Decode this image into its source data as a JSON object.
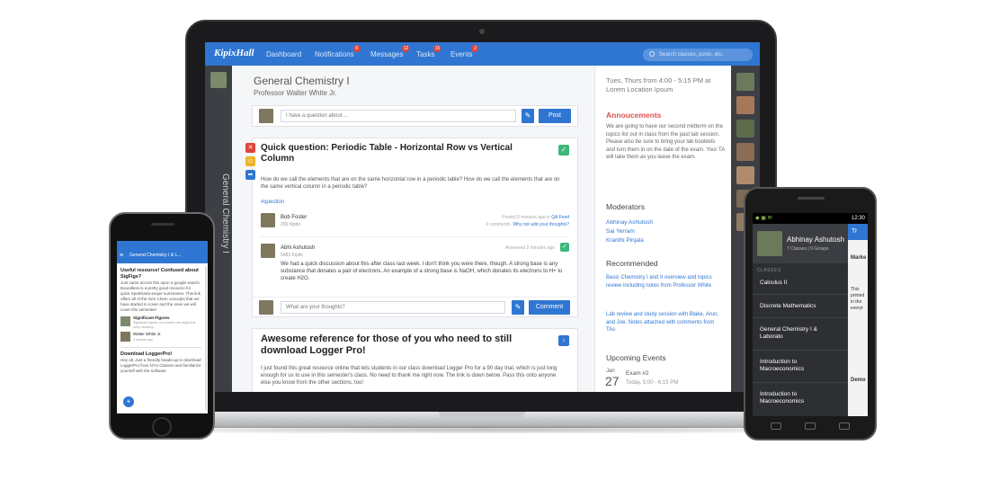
{
  "app": {
    "logo": "KipixHall",
    "nav": [
      {
        "label": "Dashboard",
        "badge": ""
      },
      {
        "label": "Notifications",
        "badge": "8"
      },
      {
        "label": "Messages",
        "badge": "12"
      },
      {
        "label": "Tasks",
        "badge": "15"
      },
      {
        "label": "Events",
        "badge": "2"
      }
    ],
    "search_placeholder": "Search classes, posts, etc.",
    "sidebar_title": "General Chemistry I"
  },
  "course": {
    "title": "General Chemistry I",
    "professor": "Professor Walter White Jr."
  },
  "composer": {
    "placeholder": "I have a question about ...",
    "post_label": "Post"
  },
  "post1": {
    "title": "Quick question: Periodic Table - Horizontal Row vs Vertical Column",
    "body": "How do we call the elements that are on the same horizontal row in a periodic table? How do we call the elements that are on the same vertical column in a periodic table?",
    "hashtag": "#question",
    "author": "Bob Foster",
    "author_points": "265 Kipits",
    "posted_meta": "Posted 5 minutes ago in",
    "posted_link": "QA Feed",
    "comments_meta": "0 comments.",
    "comments_link": "Why not add your thoughts?",
    "answer_author": "Abhi Ashutosh",
    "answer_points": "5483 Kipits",
    "answer_meta": "Answered 2 minutes ago",
    "answer_body": "We had a quick discussion about this after class last week. I don't think you were there, though. A strong base is any substance that donates a pair of electrons. An example of a strong base is NaOH, which donates its electrons to H+ to create H2O.",
    "reply_placeholder": "What are your thoughts?",
    "comment_label": "Comment"
  },
  "post2": {
    "title": "Awesome reference for those of you who need to still download Logger Pro!",
    "body": "I just found this great resource online that lets students in our class download Logger Pro for a 90 day trial, which is just long enough for us to use in this semester's class. No need to thank me right now. The link is down below. Pass this onto anyone else you know from the other sections, too!"
  },
  "right_panel": {
    "schedule": "Tues, Thurs from 4:00 - 5:15 PM at Lorem Location Ipsum",
    "announcements_title": "Annoucements",
    "announcements_body": "We are going to have our second midterm on the topics list out in class from the past lab session. Please also be sure to bring your lab booklets and turn them in on the date of the exam. Your TA will take them as you leave the exam.",
    "moderators_title": "Moderators",
    "moderators": [
      "Abhinay Ashutosh",
      "Sai Yerram",
      "Kranthi Pinjala"
    ],
    "recommended_title": "Recommended",
    "recommended": [
      "Basic Chemistry I and II overview and topics review including notes from Professor White",
      "Lab review and study session with Blake, Arun, and Joe. Notes attached with comments from TAs"
    ],
    "events_title": "Upcoming Events",
    "event_month": "Jan",
    "event_day": "27",
    "event_title": "Exam #2",
    "event_time": "Today, 5:00 - 6:15 PM"
  },
  "iphone": {
    "header": "General Chemistry I & L...",
    "post_title": "Useful resource! Confused about SigFigs?",
    "post_body": "Just came across this upon a google search. Boundless is a pretty good resource for quick SparkNote-esque summaries. This link offers all of the Gen Chem concepts that we have started to cover and the ones we will cover this semester!",
    "attachment_title": "Significant Figures",
    "attachment_sub": "Significant figures of a number are digits that carry meaning...",
    "author": "Walter White Jr.",
    "author_sub": "3 minutes ago",
    "post2_title": "Download LoggerPro!",
    "post2_body": "Hey all, Just a friendly heads-up to download LoggerPro from NYU Classes and familiarize yourself with the software"
  },
  "android": {
    "time": "12:30",
    "user_name": "Abhinay Ashutosh",
    "user_sub": "7 Classes | 9 Groups",
    "classes_label": "CLASSES",
    "classes": [
      "Calculus II",
      "Discrete Mathematics",
      "General Chemistry I & Laborato",
      "Introduction to Macroeconomics",
      "Introduction to Macroeconomics"
    ],
    "behind_header": "Tr",
    "behind_lines": [
      "Marke",
      "This printed in the everyt",
      "Demo"
    ]
  },
  "colors": {
    "primary_blue": "#2f76d2",
    "announcement_red": "#d9534f",
    "success_green": "#3cb878",
    "sidebar_dark": "#3d3f44"
  }
}
